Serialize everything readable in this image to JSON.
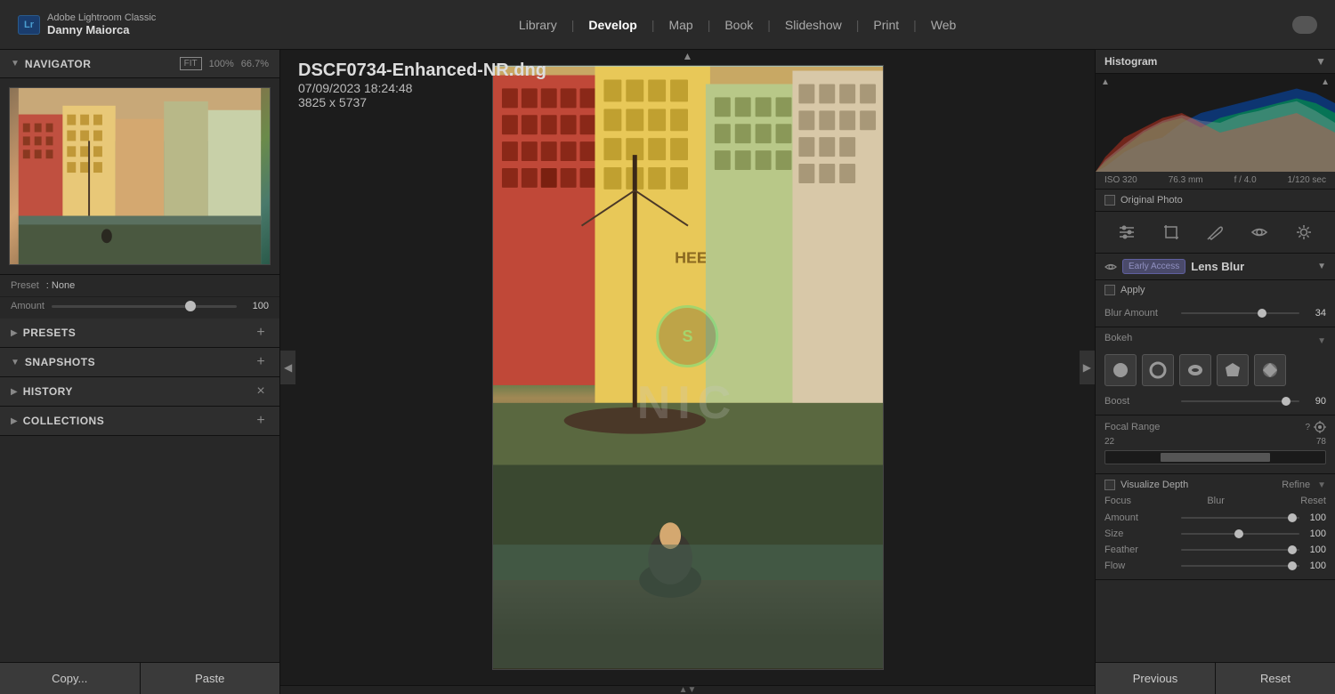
{
  "app": {
    "badge": "Lr",
    "title": "Adobe Lightroom Classic",
    "user": "Danny Maiorca"
  },
  "nav": {
    "items": [
      "Library",
      "Develop",
      "Map",
      "Book",
      "Slideshow",
      "Print",
      "Web"
    ],
    "active": "Develop"
  },
  "left_panel": {
    "navigator": {
      "title": "Navigator",
      "fit_label": "FIT",
      "zoom1": "100%",
      "zoom2": "66.7%"
    },
    "preset": {
      "label": "Preset",
      "value": ": None"
    },
    "amount": {
      "label": "Amount",
      "value": "100",
      "thumb_pct": 72
    },
    "presets": {
      "title": "Presets",
      "add_btn": "+"
    },
    "snapshots": {
      "title": "Snapshots",
      "add_btn": "+"
    },
    "history": {
      "title": "History",
      "close_btn": "×"
    },
    "collections": {
      "title": "Collections",
      "add_btn": "+"
    },
    "copy_btn": "Copy...",
    "paste_btn": "Paste"
  },
  "image": {
    "filename": "DSCF0734-Enhanced-NR.dng",
    "date": "07/09/2023 18:24:48",
    "dimensions": "3825 x 5737"
  },
  "right_panel": {
    "histogram_title": "Histogram",
    "iso": "ISO 320",
    "focal": "76.3 mm",
    "aperture": "f / 4.0",
    "shutter": "1/120 sec",
    "original_photo": "Original Photo",
    "early_access_label": "Early Access",
    "lens_blur_title": "Lens Blur",
    "apply_label": "Apply",
    "blur_amount_label": "Blur Amount",
    "blur_amount_value": "34",
    "bokeh_label": "Bokeh",
    "boost_label": "Boost",
    "boost_value": "90",
    "focal_range_label": "Focal Range",
    "focal_min": "22",
    "focal_max": "78",
    "visualize_depth": "Visualize Depth",
    "refine_label": "Refine",
    "focus_label": "Focus",
    "blur_label": "Blur",
    "reset_label": "Reset",
    "amount_label": "Amount",
    "amount_value": "100",
    "size_label": "Size",
    "size_value": "100",
    "feather_label": "Feather",
    "feather_value": "100",
    "flow_label": "Flow",
    "flow_value": "100",
    "previous_btn": "Previous",
    "reset_btn": "Reset"
  }
}
